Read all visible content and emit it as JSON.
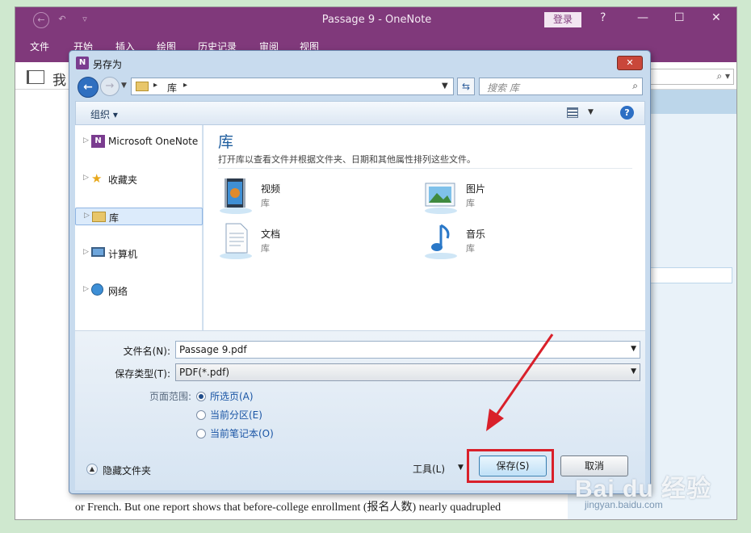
{
  "onenote": {
    "title": "Passage 9  -  OneNote",
    "login_label": "登录",
    "window_controls": [
      "?",
      "—",
      "☐",
      "✕"
    ],
    "qat": [
      "←",
      "↶",
      "▿"
    ],
    "ribbon_tabs": [
      "文件",
      "开始",
      "插入",
      "绘图",
      "历史记录",
      "审阅",
      "视图"
    ],
    "notebook_label": "我",
    "search_icon": "⌕ ▾",
    "body_text": "or French. But one report shows that before-college enrollment (报名人数) nearly quadrupled"
  },
  "dialog": {
    "title": "另存为",
    "close_label": "✕",
    "address": {
      "segment": "库"
    },
    "search_placeholder": "搜索 库",
    "toolbar": {
      "organize_label": "组织 ▾"
    },
    "nav_items": [
      {
        "label": "Microsoft OneNote",
        "icon": "onenote-icon"
      },
      {
        "label": "收藏夹",
        "icon": "star-icon"
      },
      {
        "label": "库",
        "icon": "library-icon",
        "selected": true
      },
      {
        "label": "计算机",
        "icon": "computer-icon"
      },
      {
        "label": "网络",
        "icon": "network-icon"
      }
    ],
    "library": {
      "heading": "库",
      "description": "打开库以查看文件并根据文件夹、日期和其他属性排列这些文件。",
      "items": [
        {
          "name": "视频",
          "sub": "库",
          "icon": "video-library-icon"
        },
        {
          "name": "图片",
          "sub": "库",
          "icon": "pictures-library-icon"
        },
        {
          "name": "文档",
          "sub": "库",
          "icon": "documents-library-icon"
        },
        {
          "name": "音乐",
          "sub": "库",
          "icon": "music-library-icon"
        }
      ]
    },
    "filename_label": "文件名(N):",
    "filename_value": "Passage 9.pdf",
    "filetype_label": "保存类型(T):",
    "filetype_value": "PDF(*.pdf)",
    "page_range_label": "页面范围:",
    "page_range_options": [
      {
        "label": "所选页(A)",
        "checked": true
      },
      {
        "label": "当前分区(E)",
        "checked": false
      },
      {
        "label": "当前笔记本(O)",
        "checked": false
      }
    ],
    "hide_folders_label": "隐藏文件夹",
    "tools_label": "工具(L)",
    "save_label": "保存(S)",
    "cancel_label": "取消"
  },
  "watermark": {
    "main": "Bai du 经验",
    "sub": "jingyan.baidu.com"
  },
  "colors": {
    "onenote_purple": "#80397b",
    "annotation_red": "#d9202a",
    "link_blue": "#1a55a5"
  }
}
